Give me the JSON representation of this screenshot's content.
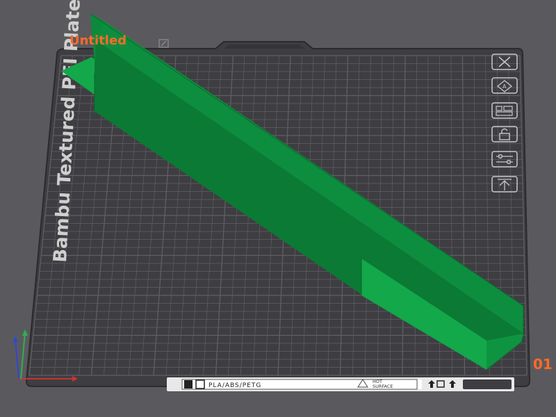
{
  "plate": {
    "name": "Untitled",
    "number": "01",
    "bed_type_label": "Bambu Textured PEI Plate",
    "material_label": "PLA/ABS/PETG",
    "warning_line1": "HOT",
    "warning_line2": "SURFACE"
  },
  "toolbar": {
    "items": [
      {
        "name": "delete-plate",
        "icon": "close-icon"
      },
      {
        "name": "auto-arrange",
        "icon": "arrange-icon"
      },
      {
        "name": "orient",
        "icon": "plate-settings-icon"
      },
      {
        "name": "lock-plate",
        "icon": "lock-icon"
      },
      {
        "name": "plate-settings",
        "icon": "sliders-icon"
      },
      {
        "name": "move-up",
        "icon": "arrow-up-icon"
      }
    ]
  },
  "colors": {
    "background": "#5a5a5e",
    "bed": "#3e3e42",
    "grid": "#6a6a70",
    "model_top": "#10a846",
    "model_side": "#0b7a34",
    "accent": "#ff6a2a"
  }
}
